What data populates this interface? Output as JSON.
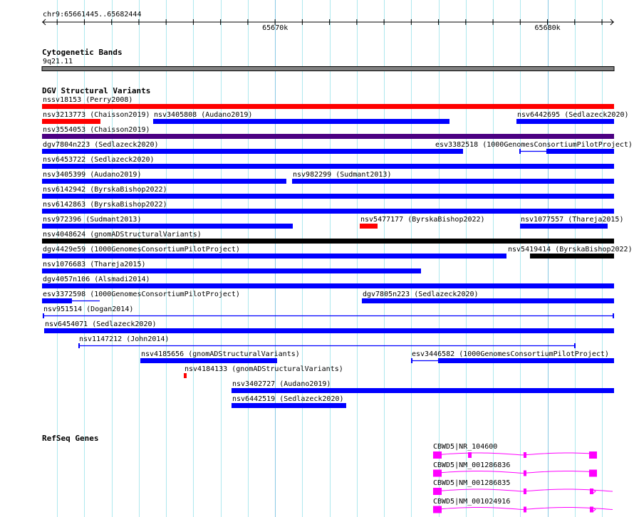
{
  "view": {
    "chrom": "chr9",
    "start": 65661445,
    "end": 65682444,
    "location_label": "chr9:65661445..65682444"
  },
  "ruler": {
    "major_ticks": [
      {
        "pos": 65670000,
        "label": "65670k"
      },
      {
        "pos": 65680000,
        "label": "65680k"
      }
    ],
    "minor_tick_step": 1000
  },
  "tracks": {
    "cytoband": {
      "title": "Cytogenetic Bands",
      "band": {
        "name": "9q21.11",
        "start": 65661445,
        "end": 65682444,
        "color": "#808080"
      }
    },
    "dgv": {
      "title": "DGV Structural Variants",
      "rows": [
        [
          {
            "label": "nssv18153 (Perry2008)",
            "start": 65661445,
            "end": 65682444,
            "color": "#ff0000"
          }
        ],
        [
          {
            "label": "nsv3213773 (Chaisson2019)",
            "start": 65661445,
            "end": 65663589,
            "color": "#ff0000"
          },
          {
            "label": "nsv3405808 (Audano2019)",
            "start": 65665524,
            "end": 65676403,
            "color": "#0000ff"
          },
          {
            "label": "nsv6442695 (Sedlazeck2020)",
            "start": 65678861,
            "end": 65682444,
            "color": "#0000ff"
          }
        ],
        [
          {
            "label": "nsv3554053 (Chaisson2019)",
            "start": 65661445,
            "end": 65682444,
            "color": "#4b0082"
          }
        ],
        [
          {
            "label": "dgv7804n223 (Sedlazeck2020)",
            "start": 65661445,
            "end": 65676900,
            "color": "#0000ff"
          },
          {
            "label": "esv3382518 (1000GenomesConsortiumPilotProject)",
            "start": 65678966,
            "end": 65682444,
            "thick_start": 65679959,
            "thick_end": 65682444,
            "color": "#0000ff"
          }
        ],
        [
          {
            "label": "nsv6453722 (Sedlazeck2020)",
            "start": 65661445,
            "end": 65682444,
            "color": "#0000ff"
          }
        ],
        [
          {
            "label": "nsv3405399 (Audano2019)",
            "start": 65661445,
            "end": 65670414,
            "color": "#0000ff"
          },
          {
            "label": "nsv982299 (Sudmant2013)",
            "start": 65670624,
            "end": 65682444,
            "color": "#0000ff"
          }
        ],
        [
          {
            "label": "nsv6142942 (ByrskaBishop2022)",
            "start": 65661445,
            "end": 65682444,
            "color": "#0000ff"
          }
        ],
        [
          {
            "label": "nsv6142863 (ByrskaBishop2022)",
            "start": 65661445,
            "end": 65682444,
            "color": "#0000ff"
          }
        ],
        [
          {
            "label": "nsv972396 (Sudmant2013)",
            "start": 65661445,
            "end": 65670650,
            "color": "#0000ff"
          },
          {
            "label": "nsv5477177 (ByrskaBishop2022)",
            "start": 65673108,
            "end": 65673762,
            "color": "#ff0000"
          },
          {
            "label": "nsv1077557 (Thareja2015)",
            "start": 65678992,
            "end": 65682208,
            "color": "#0000ff"
          }
        ],
        [
          {
            "label": "nsv4048624 (gnomADStructuralVariants)",
            "start": 65661445,
            "end": 65682444,
            "color": "#000000"
          }
        ],
        [
          {
            "label": "dgv4429e59 (1000GenomesConsortiumPilotProject)",
            "start": 65661445,
            "end": 65678495,
            "color": "#0000ff"
          },
          {
            "label": "nsv5419414 (ByrskaBishop2022)",
            "start": 65679358,
            "end": 65682444,
            "color": "#000000"
          }
        ],
        [
          {
            "label": "nsv1076683 (Thareja2015)",
            "start": 65661445,
            "end": 65675357,
            "color": "#0000ff"
          }
        ],
        [
          {
            "label": "dgv4057n106 (Alsmadi2014)",
            "start": 65661445,
            "end": 65682444,
            "color": "#0000ff"
          }
        ],
        [
          {
            "label": "esv3372598 (1000GenomesConsortiumPilotProject)",
            "start": 65661445,
            "end": 65663563,
            "thick_start": 65661445,
            "thick_end": 65662543,
            "color": "#0000ff"
          },
          {
            "label": "dgv7805n223 (Sedlazeck2020)",
            "start": 65673186,
            "end": 65682444,
            "color": "#0000ff"
          }
        ],
        [
          {
            "label": "nsv951514 (Dogan2014)",
            "start": 65661470,
            "end": 65682444,
            "thin": true,
            "color": "#0000ff"
          }
        ],
        [
          {
            "label": "nsv6454071 (Sedlazeck2020)",
            "start": 65661523,
            "end": 65682444,
            "color": "#0000ff"
          }
        ],
        [
          {
            "label": "nsv1147212 (John2014)",
            "start": 65662779,
            "end": 65681031,
            "thin": true,
            "color": "#0000ff"
          }
        ],
        [
          {
            "label": "nsv4185656 (gnomADStructuralVariants)",
            "start": 65665054,
            "end": 65670075,
            "color": "#0000ff"
          },
          {
            "label": "esv3446582 (1000GenomesConsortiumPilotProject)",
            "start": 65674991,
            "end": 65682444,
            "thick_start": 65675984,
            "thick_end": 65682444,
            "color": "#0000ff"
          }
        ],
        [
          {
            "label": "nsv4184133 (gnomADStructuralVariants)",
            "start": 65666649,
            "end": 65666753,
            "color": "#ff0000"
          }
        ],
        [
          {
            "label": "nsv3402727 (Audano2019)",
            "start": 65668401,
            "end": 65682444,
            "color": "#0000ff"
          }
        ],
        [
          {
            "label": "nsv6442519 (Sedlazeck2020)",
            "start": 65668401,
            "end": 65672611,
            "color": "#0000ff"
          }
        ]
      ]
    },
    "refseq": {
      "title": "RefSeq Genes",
      "color": "#ff00ff",
      "genes": [
        {
          "label": "CBWD5|NR_104600",
          "start": 65675801,
          "end": 65681816,
          "continues": false,
          "exons": [
            [
              65675801,
              65676115,
              "big"
            ],
            [
              65677083,
              65677214,
              "small"
            ],
            [
              65679122,
              65679227,
              "small"
            ],
            [
              65681528,
              65681816,
              "big"
            ]
          ]
        },
        {
          "label": "CBWD5|NM_001286836",
          "start": 65675801,
          "end": 65681816,
          "continues": false,
          "exons": [
            [
              65675801,
              65676115,
              "big"
            ],
            [
              65679122,
              65679227,
              "small"
            ],
            [
              65681528,
              65681816,
              "big"
            ]
          ]
        },
        {
          "label": "CBWD5|NM_001286835",
          "start": 65675801,
          "end": 65682444,
          "continues": true,
          "exons": [
            [
              65675801,
              65676115,
              "big"
            ],
            [
              65679122,
              65679227,
              "small"
            ],
            [
              65681554,
              65681685,
              "small"
            ]
          ]
        },
        {
          "label": "CBWD5|NM_001024916",
          "start": 65675801,
          "end": 65682444,
          "continues": true,
          "exons": [
            [
              65675801,
              65676115,
              "big"
            ],
            [
              65679122,
              65679227,
              "small"
            ],
            [
              65681554,
              65681685,
              "small"
            ]
          ]
        }
      ]
    }
  }
}
